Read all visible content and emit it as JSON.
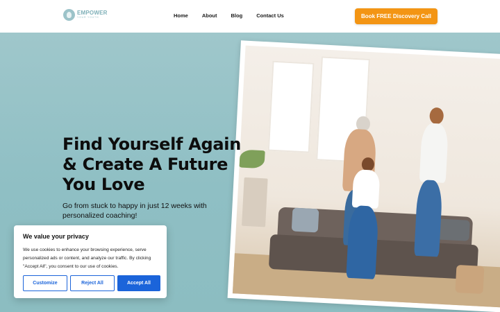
{
  "header": {
    "logo_name": "EMPOWER",
    "logo_tagline": "YOUR YOUTH",
    "nav": [
      {
        "label": "Home"
      },
      {
        "label": "About"
      },
      {
        "label": "Blog"
      },
      {
        "label": "Contact Us"
      }
    ],
    "cta_label": "Book FREE Discovery Call"
  },
  "hero": {
    "title_lines": [
      "Find Yourself Again",
      "& Create A Future",
      "You Love"
    ],
    "subtitle": "Go from stuck to happy in just 12 weeks with personalized coaching!"
  },
  "cookie_banner": {
    "title": "We value your privacy",
    "text": "We use cookies to enhance your browsing experience, serve personalized ads or content, and analyze our traffic. By clicking \"Accept All\", you consent to our use of cookies.",
    "buttons": {
      "customize": "Customize",
      "reject": "Reject All",
      "accept": "Accept All"
    }
  },
  "colors": {
    "accent": "#f39514",
    "hero_bg": "#8fbfc4",
    "cookie_button": "#1b64da"
  }
}
